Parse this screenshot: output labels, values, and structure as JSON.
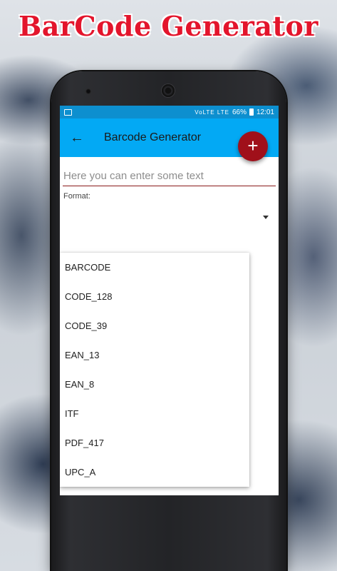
{
  "promo": {
    "title": "BarCode Generator"
  },
  "statusbar": {
    "icons": "VoLTE LTE",
    "battery": "66%",
    "time": "12:01"
  },
  "appbar": {
    "back_icon": "←",
    "title": "Barcode Generator"
  },
  "fab": {
    "icon": "+"
  },
  "input": {
    "placeholder": "Here you can enter some text",
    "value": ""
  },
  "format": {
    "label": "Format:",
    "options": [
      "BARCODE",
      "CODE_128",
      "CODE_39",
      "EAN_13",
      "EAN_8",
      "ITF",
      "PDF_417",
      "UPC_A"
    ]
  },
  "colors": {
    "accent": "#a0101a",
    "appbar": "#03a9f4",
    "statusbar": "#0d8fcf",
    "promo": "#e3152c"
  }
}
